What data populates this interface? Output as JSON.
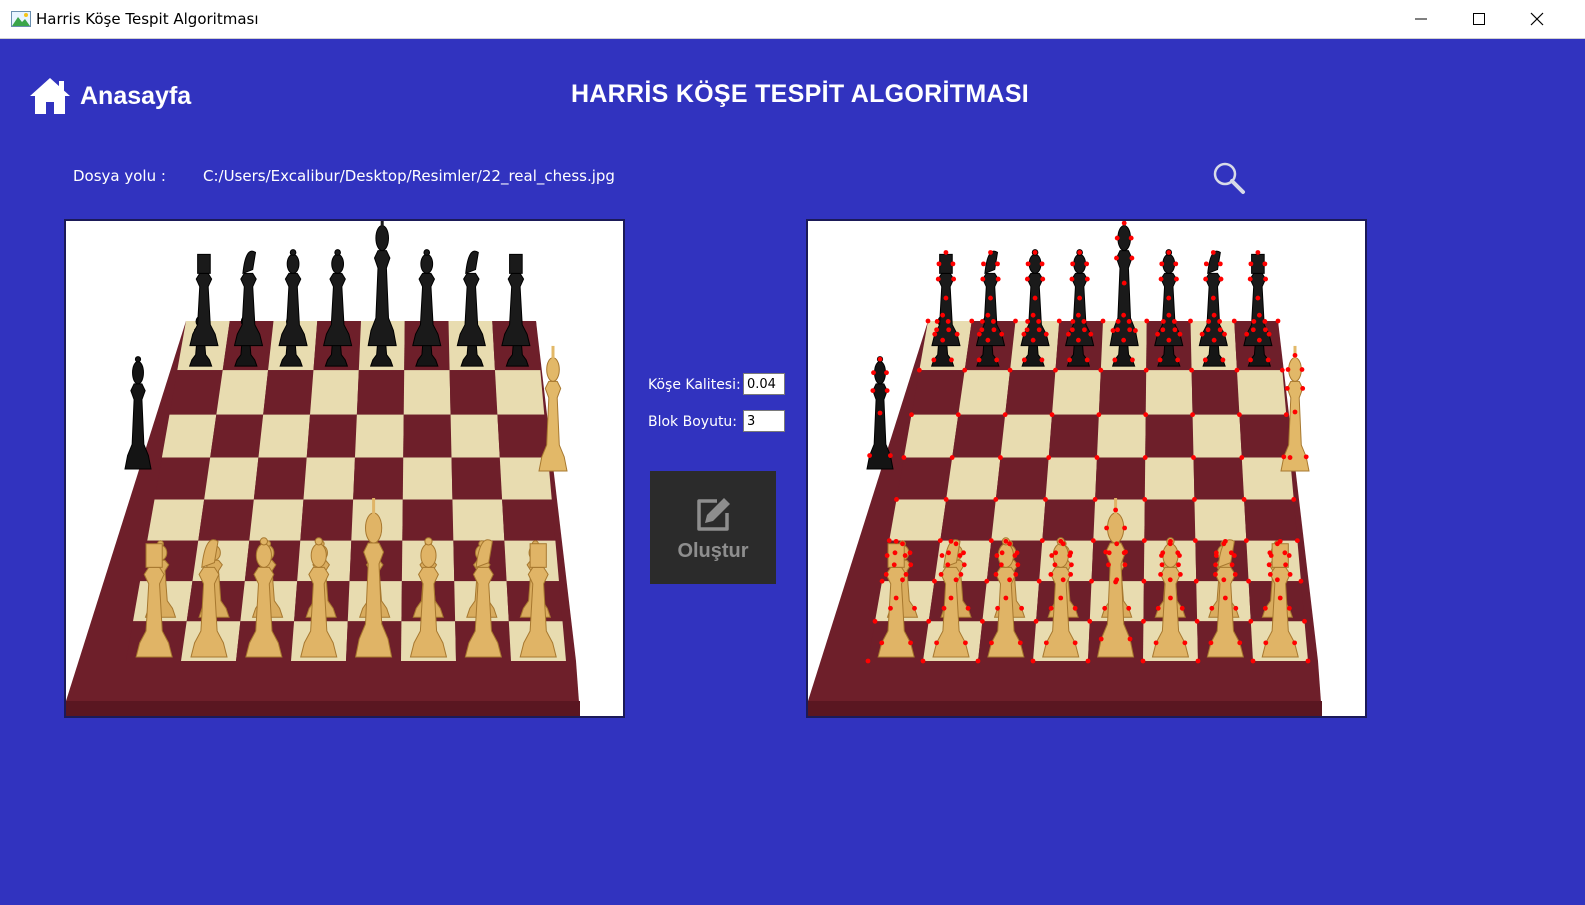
{
  "window": {
    "title": "Harris Köşe Tespit Algoritması",
    "controls": [
      "minimize",
      "maximize",
      "close"
    ]
  },
  "header": {
    "home_label": "Anasayfa",
    "page_title": "HARRİS KÖŞE TESPİT ALGORİTMASI"
  },
  "file": {
    "path_label": "Dosya yolu :",
    "path_value": "C:/Users/Excalibur/Desktop/Resimler/22_real_chess.jpg"
  },
  "params": {
    "corner_quality_label": "Köşe Kalitesi:",
    "corner_quality_value": "0.04",
    "block_size_label": "Blok Boyutu:",
    "block_size_value": "3"
  },
  "actions": {
    "create_label": "Oluştur"
  },
  "images": {
    "input": "chess board photo (original)",
    "output": "chess board photo with Harris corners marked in red"
  },
  "colors": {
    "background": "#3133bf",
    "titlebar": "#ffffff",
    "button_bg": "#2b2b2b",
    "button_text": "#8e8e8e",
    "corner_marker": "#ff0000",
    "board_dark": "#6e1f2a",
    "board_light": "#e8dcb0"
  },
  "icons": [
    "app-icon",
    "minimize-icon",
    "maximize-icon",
    "close-icon",
    "home-icon",
    "search-icon",
    "edit-icon"
  ]
}
